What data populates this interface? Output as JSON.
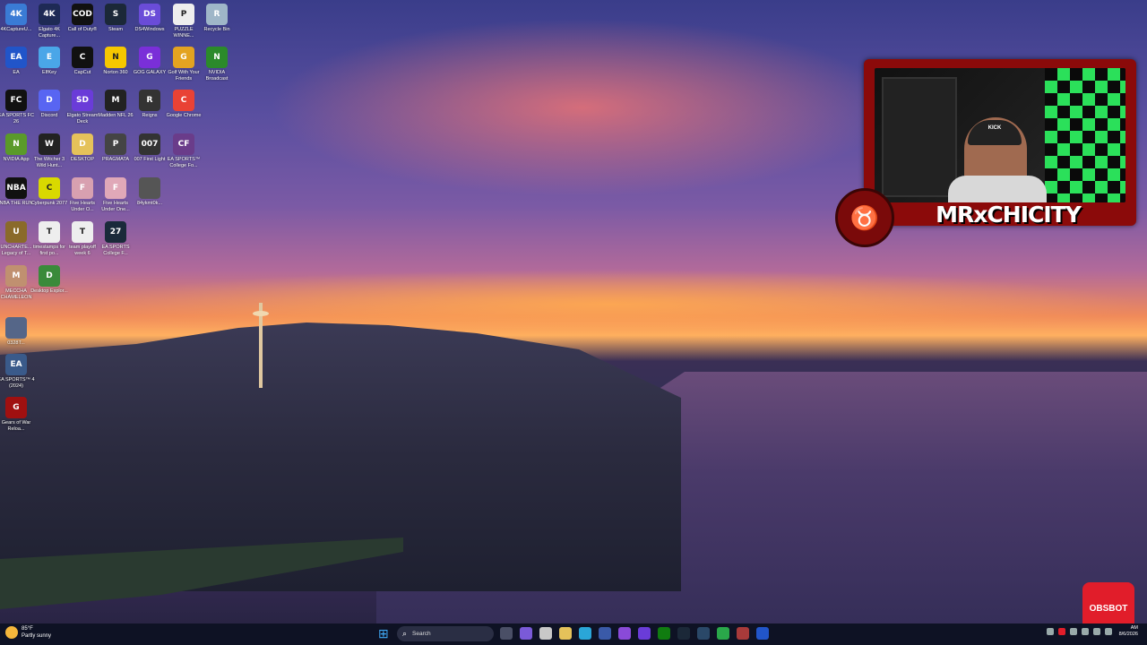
{
  "desktop_icons": [
    {
      "label": "4KCaptureU...",
      "glyph": "4K",
      "color": "#3a7bd5"
    },
    {
      "label": "Elgato 4K Capture...",
      "glyph": "4K",
      "color": "#1e2a55"
    },
    {
      "label": "Call of Duty®",
      "glyph": "COD",
      "color": "#111111"
    },
    {
      "label": "Steam",
      "glyph": "S",
      "color": "#1b2838"
    },
    {
      "label": "DS4Windows",
      "glyph": "DS",
      "color": "#6a4cd8"
    },
    {
      "label": "PUZZLE WINNE...",
      "glyph": "P",
      "color": "#eeeeee"
    },
    {
      "label": "Recycle Bin",
      "glyph": "R",
      "color": "#9fb6c8"
    },
    {
      "label": "EA",
      "glyph": "EA",
      "color": "#2155c9"
    },
    {
      "label": "ElfKey",
      "glyph": "E",
      "color": "#4aa6e8"
    },
    {
      "label": "CapCut",
      "glyph": "C",
      "color": "#111111"
    },
    {
      "label": "Norton 360",
      "glyph": "N",
      "color": "#f6c700"
    },
    {
      "label": "GOG GALAXY",
      "glyph": "G",
      "color": "#7a2fd8"
    },
    {
      "label": "Golf With Your Friends",
      "glyph": "G",
      "color": "#e3a321"
    },
    {
      "label": "NVIDIA Broadcast",
      "glyph": "N",
      "color": "#2b8a2b"
    },
    {
      "label": "EA SPORTS FC 26",
      "glyph": "FC",
      "color": "#111111"
    },
    {
      "label": "Discord",
      "glyph": "D",
      "color": "#5865f2"
    },
    {
      "label": "Elgato Stream Deck",
      "glyph": "SD",
      "color": "#6a3cd8"
    },
    {
      "label": "Madden NFL 26",
      "glyph": "M",
      "color": "#222222"
    },
    {
      "label": "Reigns",
      "glyph": "R",
      "color": "#333333"
    },
    {
      "label": "Google Chrome",
      "glyph": "C",
      "color": "#e94235"
    },
    {
      "label": "NVIDIA App",
      "glyph": "N",
      "color": "#5a9a2a"
    },
    {
      "label": "The Witcher 3 Wild Hunt...",
      "glyph": "W",
      "color": "#222222"
    },
    {
      "label": "DESKTOP",
      "glyph": "D",
      "color": "#e5c25a"
    },
    {
      "label": "PRAGMATA",
      "glyph": "P",
      "color": "#444444"
    },
    {
      "label": "007 First Light",
      "glyph": "007",
      "color": "#333333"
    },
    {
      "label": "EA SPORTS™ College Fo...",
      "glyph": "CF",
      "color": "#6a3c8a"
    },
    {
      "label": "NBA THE RUN",
      "glyph": "NBA",
      "color": "#111111"
    },
    {
      "label": "Cyberpunk 2077",
      "glyph": "C",
      "color": "#d9d900"
    },
    {
      "label": "Five Hearts Under O...",
      "glyph": "F",
      "color": "#d8a0b0"
    },
    {
      "label": "Five Hearts Under One...",
      "glyph": "F",
      "color": "#e0a8b8"
    },
    {
      "label": "84ykmt0k...",
      "glyph": "",
      "color": "#555555"
    },
    {
      "label": "UNCHARTE... Legacy of T...",
      "glyph": "U",
      "color": "#8a6a2a"
    },
    {
      "label": "timestamps for first po...",
      "glyph": "T",
      "color": "#eeeeee"
    },
    {
      "label": "team playoff week 6",
      "glyph": "T",
      "color": "#eeeeee"
    },
    {
      "label": "EA SPORTS College F...",
      "glyph": "27",
      "color": "#1a2a3a"
    },
    {
      "label": "MECCHA CHAMELEON",
      "glyph": "M",
      "color": "#c09070"
    },
    {
      "label": "Desktop Explor...",
      "glyph": "D",
      "color": "#3a8a3a"
    },
    {
      "label": "0328T...",
      "glyph": "",
      "color": "#556688"
    },
    {
      "label": "EA SPORTS™ 4 (2024)",
      "glyph": "EA",
      "color": "#3a5a8a"
    },
    {
      "label": "Gears of War Reloa...",
      "glyph": "G",
      "color": "#a01010"
    }
  ],
  "overlay": {
    "channel_name": "MRxCHICITY",
    "cap_text": "KICK"
  },
  "obsbot": {
    "label": "OBSBOT"
  },
  "taskbar": {
    "weather_temp": "85°F",
    "weather_desc": "Partly sunny",
    "search_placeholder": "Search",
    "clock_time": "AM",
    "clock_date": "8/6/2026"
  },
  "colors": {
    "accent": "#3fa9f5",
    "overlay_red": "#8b0a0a",
    "obsbot_red": "#e11d2a",
    "taskbar_bg": "#0e1224"
  }
}
